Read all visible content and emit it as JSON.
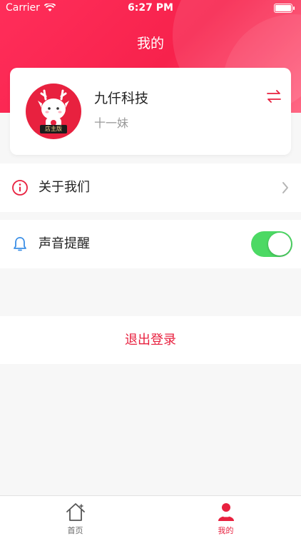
{
  "status_bar": {
    "carrier": "Carrier",
    "time": "6:27 PM"
  },
  "header": {
    "title": "我的"
  },
  "profile": {
    "company": "九仟科技",
    "user": "十一妹",
    "avatar_badge": "店主版"
  },
  "menu": {
    "about": {
      "label": "关于我们",
      "icon": "info-circle-icon"
    },
    "sound": {
      "label": "声音提醒",
      "icon": "bell-icon",
      "enabled": true
    }
  },
  "logout_label": "退出登录",
  "tabbar": {
    "tabs": [
      {
        "label": "首页",
        "icon": "home-icon",
        "active": false
      },
      {
        "label": "我的",
        "icon": "user-icon",
        "active": true
      }
    ]
  },
  "colors": {
    "accent": "#e8213f",
    "toggle_on": "#4cd964"
  }
}
